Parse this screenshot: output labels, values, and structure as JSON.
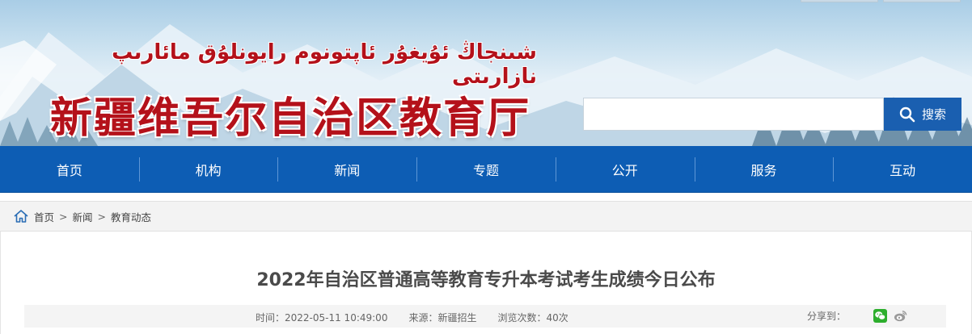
{
  "header": {
    "title_uyghur": "شىنجاڭ ئۇيغۇر ئاپتونوم رايونلۇق مائارىپ نازارىتى",
    "title_chinese": "新疆维吾尔自治区教育厅",
    "search": {
      "placeholder": "",
      "value": "",
      "button_label": "搜索"
    }
  },
  "nav": {
    "items": [
      {
        "label": "首页"
      },
      {
        "label": "机构"
      },
      {
        "label": "新闻"
      },
      {
        "label": "专题"
      },
      {
        "label": "公开"
      },
      {
        "label": "服务"
      },
      {
        "label": "互动"
      }
    ]
  },
  "breadcrumb": {
    "items": [
      "首页",
      "新闻",
      "教育动态"
    ],
    "separator": ">"
  },
  "article": {
    "title": "2022年自治区普通高等教育专升本考试考生成绩今日公布",
    "meta": {
      "time": "时间：2022-05-11 10:49:00",
      "source": "来源：新疆招生",
      "views": "浏览次数：40次"
    },
    "share_label": "分享到："
  },
  "icons": {
    "home": "home-icon",
    "search": "search-icon",
    "wechat": "wechat-icon",
    "weibo": "weibo-icon"
  },
  "colors": {
    "brand_red": "#b4111a",
    "nav_blue": "#0d5db4",
    "search_button_blue": "#1a5fb0",
    "wechat_green": "#2dae2d",
    "weibo_gray": "#9a9a9a"
  }
}
